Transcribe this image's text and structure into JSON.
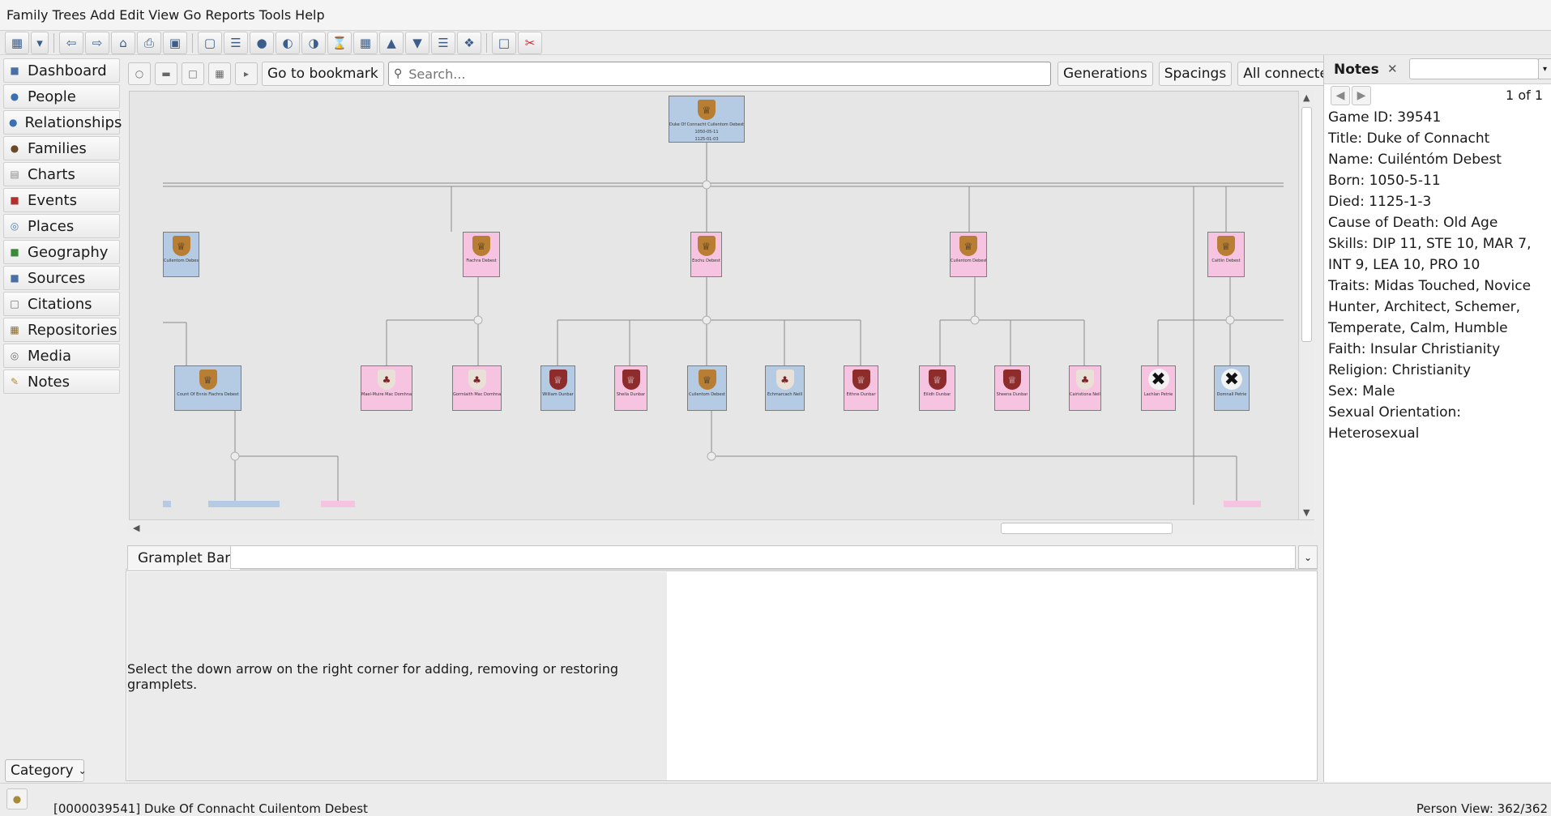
{
  "menu": [
    "Family Trees",
    "Add",
    "Edit",
    "View",
    "Go",
    "Reports",
    "Tools",
    "Help"
  ],
  "toolbar_icons": [
    "family-trees-icon",
    "dropdown-icon",
    "back-icon",
    "forward-icon",
    "home-icon",
    "print-icon",
    "clipboard-icon",
    "person-view-icon",
    "relationship-view-icon",
    "pedigree-icon",
    "fan-chart-icon",
    "descendant-fan-icon",
    "hourglass-icon",
    "graph-view-icon",
    "ancestry-icon",
    "descendants-icon",
    "tree-icon",
    "network-icon",
    "reports-icon",
    "tools-icon"
  ],
  "sidebar": {
    "items": [
      {
        "label": "Dashboard",
        "icon": "dashboard-icon",
        "color": "#4a6fa5"
      },
      {
        "label": "People",
        "icon": "people-icon",
        "color": "#3a6fb0"
      },
      {
        "label": "Relationships",
        "icon": "relationships-icon",
        "color": "#3a6fb0"
      },
      {
        "label": "Families",
        "icon": "families-icon",
        "color": "#6b4a2a"
      },
      {
        "label": "Charts",
        "icon": "charts-icon",
        "color": "#888888"
      },
      {
        "label": "Events",
        "icon": "events-icon",
        "color": "#b03030"
      },
      {
        "label": "Places",
        "icon": "places-icon",
        "color": "#4a7ab0"
      },
      {
        "label": "Geography",
        "icon": "geography-icon",
        "color": "#3a8a3a"
      },
      {
        "label": "Sources",
        "icon": "sources-icon",
        "color": "#4a6fa5"
      },
      {
        "label": "Citations",
        "icon": "citations-icon",
        "color": "#6b6b6b"
      },
      {
        "label": "Repositories",
        "icon": "repositories-icon",
        "color": "#8a6a30"
      },
      {
        "label": "Media",
        "icon": "media-icon",
        "color": "#6b6b6b"
      },
      {
        "label": "Notes",
        "icon": "notes-icon",
        "color": "#b08a30"
      }
    ],
    "category_label": "Category"
  },
  "pedigree_toolbar": {
    "bookmark_label": "Go to bookmark",
    "search_placeholder": "Search...",
    "generations_label": "Generations",
    "spacings_label": "Spacings",
    "all_connected_label": "All connected"
  },
  "tree": {
    "root": {
      "name": "Duke Of Connacht Cuilentom Debest",
      "sex": "m",
      "shield": "gold",
      "born": "1050-05-11",
      "died": "1125-01-03"
    },
    "children": [
      {
        "name": "Cuilentom Debest",
        "sex": "m",
        "shield": "gold"
      },
      {
        "name": "Fiachra Debest",
        "sex": "f",
        "shield": "gold"
      },
      {
        "name": "Eochu Debest",
        "sex": "f",
        "shield": "gold"
      },
      {
        "name": "Cuilentom Debest",
        "sex": "f",
        "shield": "gold"
      },
      {
        "name": "Caitlin Debest",
        "sex": "f",
        "shield": "gold"
      }
    ],
    "grandchildren": [
      {
        "name": "Count Of Ennis Fiachra Debest",
        "sex": "m",
        "shield": "gold"
      },
      {
        "name": "Mael-Muire Mac Domhnaill",
        "sex": "f",
        "shield": "white"
      },
      {
        "name": "Gormlaith Mac Domhnaill",
        "sex": "f",
        "shield": "white"
      },
      {
        "name": "William Dunbar",
        "sex": "m",
        "shield": "red"
      },
      {
        "name": "Sheila Dunbar",
        "sex": "f",
        "shield": "red"
      },
      {
        "name": "Cuilentom Debest",
        "sex": "m",
        "shield": "gold"
      },
      {
        "name": "Echmarcach Neill",
        "sex": "m",
        "shield": "white"
      },
      {
        "name": "Eithne Dunbar",
        "sex": "f",
        "shield": "red"
      },
      {
        "name": "Eilidh Dunbar",
        "sex": "f",
        "shield": "red"
      },
      {
        "name": "Sheena Dunbar",
        "sex": "f",
        "shield": "red"
      },
      {
        "name": "Cairistiona Neill",
        "sex": "f",
        "shield": "white"
      },
      {
        "name": "Lachlan Petrie",
        "sex": "f",
        "shield": "dead"
      },
      {
        "name": "Domnall Petrie",
        "sex": "m",
        "shield": "dead"
      }
    ]
  },
  "gramplet": {
    "tab_label": "Gramplet Bar",
    "message": "Select the down arrow on the right corner for adding, removing or restoring gramplets."
  },
  "notes": {
    "tab_label": "Notes",
    "count": "1 of 1",
    "lines": [
      "Game ID: 39541",
      "Title: Duke of Connacht",
      "Name: Cuiléntóm Debest",
      "Born: 1050-5-11",
      "Died: 1125-1-3",
      "Cause of Death: Old Age",
      "Skills: DIP 11, STE 10, MAR 7, INT 9, LEA 10, PRO 10",
      "Traits: Midas Touched, Novice Hunter, Architect, Schemer, Temperate, Calm, Humble",
      "Faith: Insular Christianity",
      "Religion: Christianity",
      "Sex: Male",
      "Sexual Orientation: Heterosexual"
    ]
  },
  "status": {
    "text": "[0000039541] Duke Of Connacht Cuilentom Debest",
    "right": "Person View: 362/362"
  },
  "colors": {
    "male": "#b4cbe3",
    "female": "#f6c4e0",
    "background": "#e6e6e6"
  }
}
